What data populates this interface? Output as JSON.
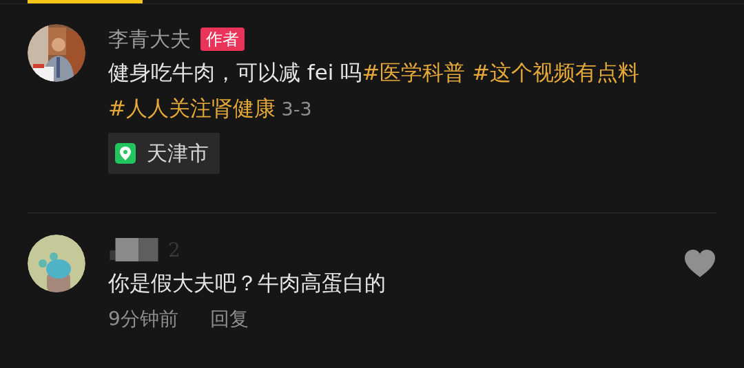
{
  "tab_indicator": {
    "selected": true
  },
  "comments": [
    {
      "kind": "author",
      "username": "李青大夫",
      "badge": "作者",
      "segments": [
        {
          "kind": "text",
          "text": "健身吃牛肉，可以减 fei 吗"
        },
        {
          "kind": "hashtag",
          "text": "#医学科普 #这个视频有点料 #人人关注肾健康"
        },
        {
          "kind": "date",
          "text": " 3-3"
        }
      ],
      "location": "天津市"
    },
    {
      "kind": "reply",
      "username_visible": "2",
      "text": "你是假大夫吧？牛肉高蛋白的",
      "time": "9分钟前",
      "reply_label": "回复",
      "liked": false
    }
  ]
}
